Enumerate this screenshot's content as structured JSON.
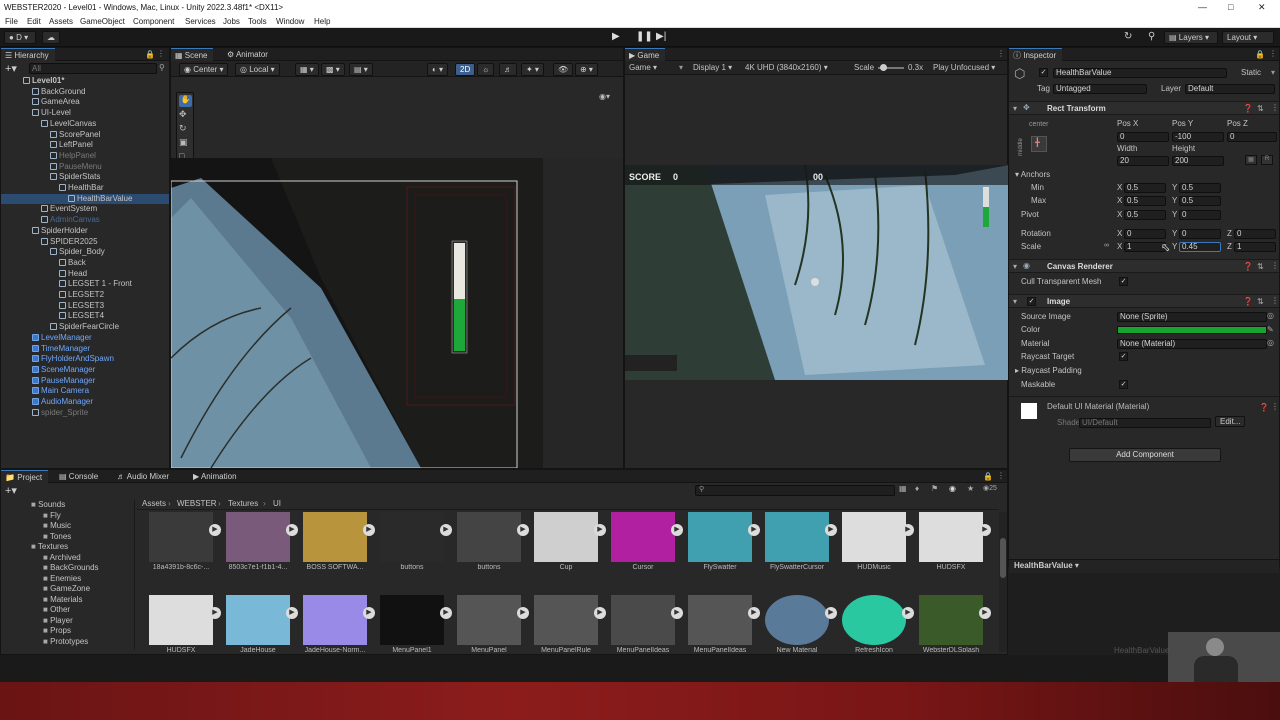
{
  "window": {
    "title": "WEBSTER2020 - Level01 - Windows, Mac, Linux - Unity 2022.3.48f1* <DX11>"
  },
  "menu": [
    "File",
    "Edit",
    "Assets",
    "GameObject",
    "Component",
    "Services",
    "Jobs",
    "Tools",
    "Window",
    "Help"
  ],
  "toolbar": {
    "account": "D",
    "layers": "Layers",
    "layout": "Layout"
  },
  "hierarchy": {
    "tab": "Hierarchy",
    "search_placeholder": "All",
    "items": [
      {
        "label": "Level01*",
        "indent": 0,
        "style": "scene"
      },
      {
        "label": "BackGround",
        "indent": 1
      },
      {
        "label": "GameArea",
        "indent": 1
      },
      {
        "label": "UI-Level",
        "indent": 1
      },
      {
        "label": "LevelCanvas",
        "indent": 2
      },
      {
        "label": "ScorePanel",
        "indent": 3
      },
      {
        "label": "LeftPanel",
        "indent": 3
      },
      {
        "label": "HelpPanel",
        "indent": 3,
        "style": "dim"
      },
      {
        "label": "PauseMenu",
        "indent": 3,
        "style": "dim"
      },
      {
        "label": "SpiderStats",
        "indent": 3
      },
      {
        "label": "HealthBar",
        "indent": 4
      },
      {
        "label": "HealthBarValue",
        "indent": 5,
        "style": "selected"
      },
      {
        "label": "EventSystem",
        "indent": 2
      },
      {
        "label": "AdminCanvas",
        "indent": 2,
        "style": "dimblue"
      },
      {
        "label": "SpiderHolder",
        "indent": 1
      },
      {
        "label": "SPIDER2025",
        "indent": 2
      },
      {
        "label": "Spider_Body",
        "indent": 3
      },
      {
        "label": "Back",
        "indent": 4
      },
      {
        "label": "Head",
        "indent": 4
      },
      {
        "label": "LEGSET 1 - Front",
        "indent": 4
      },
      {
        "label": "LEGSET2",
        "indent": 4
      },
      {
        "label": "LEGSET3",
        "indent": 4
      },
      {
        "label": "LEGSET4",
        "indent": 4
      },
      {
        "label": "SpiderFearCircle",
        "indent": 3
      },
      {
        "label": "LevelManager",
        "indent": 1,
        "style": "prefab"
      },
      {
        "label": "TimeManager",
        "indent": 1,
        "style": "prefab"
      },
      {
        "label": "FlyHolderAndSpawn",
        "indent": 1,
        "style": "prefab"
      },
      {
        "label": "SceneManager",
        "indent": 1,
        "style": "prefab"
      },
      {
        "label": "PauseManager",
        "indent": 1,
        "style": "prefab"
      },
      {
        "label": "Main Camera",
        "indent": 1,
        "style": "prefab"
      },
      {
        "label": "AudioManager",
        "indent": 1,
        "style": "prefab"
      },
      {
        "label": "spider_Sprite",
        "indent": 1,
        "style": "dim"
      }
    ]
  },
  "scene": {
    "tabs": [
      "Scene",
      "Animator"
    ],
    "pivot": "Center",
    "space": "Local",
    "mode2d": "2D"
  },
  "game": {
    "tab": "Game",
    "mode": "Game",
    "display": "Display 1",
    "resolution": "4K UHD (3840x2160)",
    "scale_label": "Scale",
    "scale_value": "0.3x",
    "play_mode": "Play Unfocused",
    "score_label": "SCORE",
    "score_value": "0",
    "timer": "00"
  },
  "inspector": {
    "tab": "Inspector",
    "object_name": "HealthBarValue",
    "static_label": "Static",
    "tag_label": "Tag",
    "tag_value": "Untagged",
    "layer_label": "Layer",
    "layer_value": "Default",
    "rect": {
      "title": "Rect Transform",
      "anchor_h": "center",
      "anchor_v": "middle",
      "posx_label": "Pos X",
      "posy_label": "Pos Y",
      "posz_label": "Pos Z",
      "posx": "0",
      "posy": "-100",
      "posz": "0",
      "width_label": "Width",
      "height_label": "Height",
      "width": "20",
      "height": "200",
      "anchors_label": "Anchors",
      "min_label": "Min",
      "max_label": "Max",
      "pivot_label": "Pivot",
      "min_x": "0.5",
      "min_y": "0.5",
      "max_x": "0.5",
      "max_y": "0.5",
      "pivot_x": "0.5",
      "pivot_y": "0",
      "rotation_label": "Rotation",
      "rot_x": "0",
      "rot_y": "0",
      "rot_z": "0",
      "scale_label": "Scale",
      "scale_x": "1",
      "scale_y": "0.45",
      "scale_z": "1",
      "x": "X",
      "y": "Y",
      "z": "Z"
    },
    "canvas_renderer": {
      "title": "Canvas Renderer",
      "cull_label": "Cull Transparent Mesh"
    },
    "image": {
      "title": "Image",
      "source_label": "Source Image",
      "source_value": "None (Sprite)",
      "color_label": "Color",
      "color_hex": "#1aa32e",
      "material_label": "Material",
      "material_value": "None (Material)",
      "raycast_target": "Raycast Target",
      "raycast_padding": "Raycast Padding",
      "maskable": "Maskable"
    },
    "material_block": {
      "name": "Default UI Material (Material)",
      "shader_label": "Shader",
      "shader_value": "UI/Default",
      "edit": "Edit..."
    },
    "add_component": "Add Component",
    "preview_label": "HealthBarValue"
  },
  "project": {
    "tabs": [
      "Project",
      "Console",
      "Audio Mixer",
      "Animation"
    ],
    "breadcrumb": [
      "Assets",
      "WEBSTER",
      "Textures",
      "UI"
    ],
    "count": "25",
    "folders": [
      {
        "label": "Sounds",
        "indent": 0
      },
      {
        "label": "Fly",
        "indent": 1
      },
      {
        "label": "Music",
        "indent": 1
      },
      {
        "label": "Tones",
        "indent": 1
      },
      {
        "label": "Textures",
        "indent": 0
      },
      {
        "label": "Archived",
        "indent": 1
      },
      {
        "label": "BackGrounds",
        "indent": 1
      },
      {
        "label": "Enemies",
        "indent": 1
      },
      {
        "label": "GameZone",
        "indent": 1
      },
      {
        "label": "Materials",
        "indent": 1
      },
      {
        "label": "Other",
        "indent": 1
      },
      {
        "label": "Player",
        "indent": 1
      },
      {
        "label": "Props",
        "indent": 1
      },
      {
        "label": "Prototypes",
        "indent": 1
      }
    ],
    "assets_row1": [
      "18a4391b-8c6c-...",
      "8503c7e1-f1b1-4...",
      "BOSS SOFTWA...",
      "buttons",
      "buttons",
      "Cup",
      "Cursor",
      "FlySwatter",
      "FlySwatterCursor",
      "HUDMusic",
      "HUDSFX"
    ],
    "assets_row2": [
      "HUDSFX",
      "JadeHouse",
      "JadeHouse-Norm...",
      "MenuPanel1",
      "MenuPanel",
      "MenuPanelRule",
      "MenuPanelIdeas",
      "MenuPanelIdeas",
      "New Material",
      "RefreshIcon",
      "WebsterDLSplash"
    ]
  },
  "watermark": "HealthBarValue"
}
